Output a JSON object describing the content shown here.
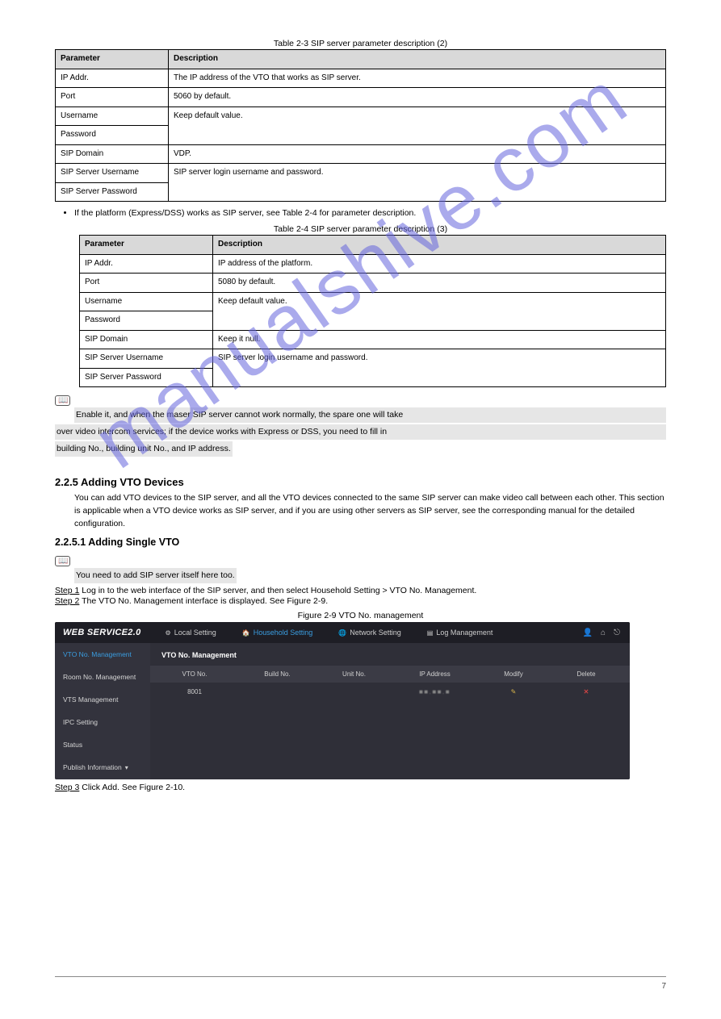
{
  "tables": {
    "t1": {
      "caption": "Table 2-3 SIP server parameter description (2)",
      "headers": {
        "param": "Parameter",
        "desc": "Description"
      },
      "rows": [
        {
          "param": "IP Addr.",
          "desc": "The IP address of the VTO that works as SIP server."
        },
        {
          "param": "Port",
          "desc": "5060 by default."
        },
        {
          "param": "Username",
          "desc_rowspan": "Keep default value."
        },
        {
          "param": "Password"
        },
        {
          "param": "SIP Domain",
          "desc": "VDP."
        },
        {
          "param": "SIP Server Username",
          "desc_rowspan": "SIP server login username and password."
        },
        {
          "param": "SIP Server Password"
        }
      ]
    },
    "t2": {
      "caption": "Table 2-4 SIP server parameter description (3)",
      "headers": {
        "param": "Parameter",
        "desc": "Description"
      },
      "rows": [
        {
          "param": "IP Addr.",
          "desc": "IP address of the platform."
        },
        {
          "param": "Port",
          "desc": "5080 by default."
        },
        {
          "param": "Username",
          "desc_rowspan": "Keep default value."
        },
        {
          "param": "Password"
        },
        {
          "param": "SIP Domain",
          "desc": "Keep it null."
        },
        {
          "param": "SIP Server Username",
          "desc_rowspan": "SIP server login username and password."
        },
        {
          "param": "SIP Server Password"
        }
      ]
    }
  },
  "intro_t2": {
    "bullet": "If the platform (Express/DSS) works as SIP server, see Table 2-4 for parameter description."
  },
  "notes_t2": {
    "line1": "Enable it, and when the maser SIP server cannot work normally, the spare one will take",
    "line2": "over video intercom services; if the device works with Express or DSS, you need to fill in",
    "line3": "building No., building unit No., and IP address."
  },
  "sections": {
    "h2": "2.2.5 Adding VTO Devices",
    "h2_body": "You can add VTO devices to the SIP server, and all the VTO devices connected to the same SIP server can make video call between each other. This section is applicable when a VTO device works as SIP server, and if you are using other servers as SIP server, see the corresponding manual for the detailed configuration.",
    "h3": "2.2.5.1 Adding Single VTO",
    "h3_note": "You need to add SIP server itself here too."
  },
  "steps": {
    "s1_label": "Step 1",
    "s1_text": "Log in to the web interface of the SIP server, and then select Household Setting > VTO No. Management.",
    "s2_label": "Step 2",
    "s2_text": "The VTO No. Management interface is displayed. See Figure 2-9.",
    "s3_label": "Step 3",
    "s3_text": "Click Add. See Figure 2-10.",
    "fig_caption": "Figure 2-9 VTO No. management"
  },
  "screenshot": {
    "logo": "WEB SERVICE2.0",
    "tabs": {
      "local": "Local Setting",
      "house": "Household Setting",
      "net": "Network Setting",
      "log": "Log Management"
    },
    "top_icons": {
      "user": "user-icon",
      "home": "home-icon",
      "exit": "exit-icon"
    },
    "side": {
      "vto": "VTO No. Management",
      "room": "Room No. Management",
      "vts": "VTS Management",
      "ipc": "IPC Setting",
      "status": "Status",
      "publish": "Publish Information"
    },
    "content_title": "VTO No. Management",
    "thead": {
      "vto": "VTO No.",
      "build": "Build No.",
      "unit": "Unit No.",
      "ip": "IP Address",
      "mod": "Modify",
      "del": "Delete"
    },
    "row1": {
      "vto": "8001",
      "build": "",
      "unit": "",
      "ip": "■■.■■.■",
      "mod": "✎",
      "del": "✕"
    }
  },
  "footer": "7"
}
